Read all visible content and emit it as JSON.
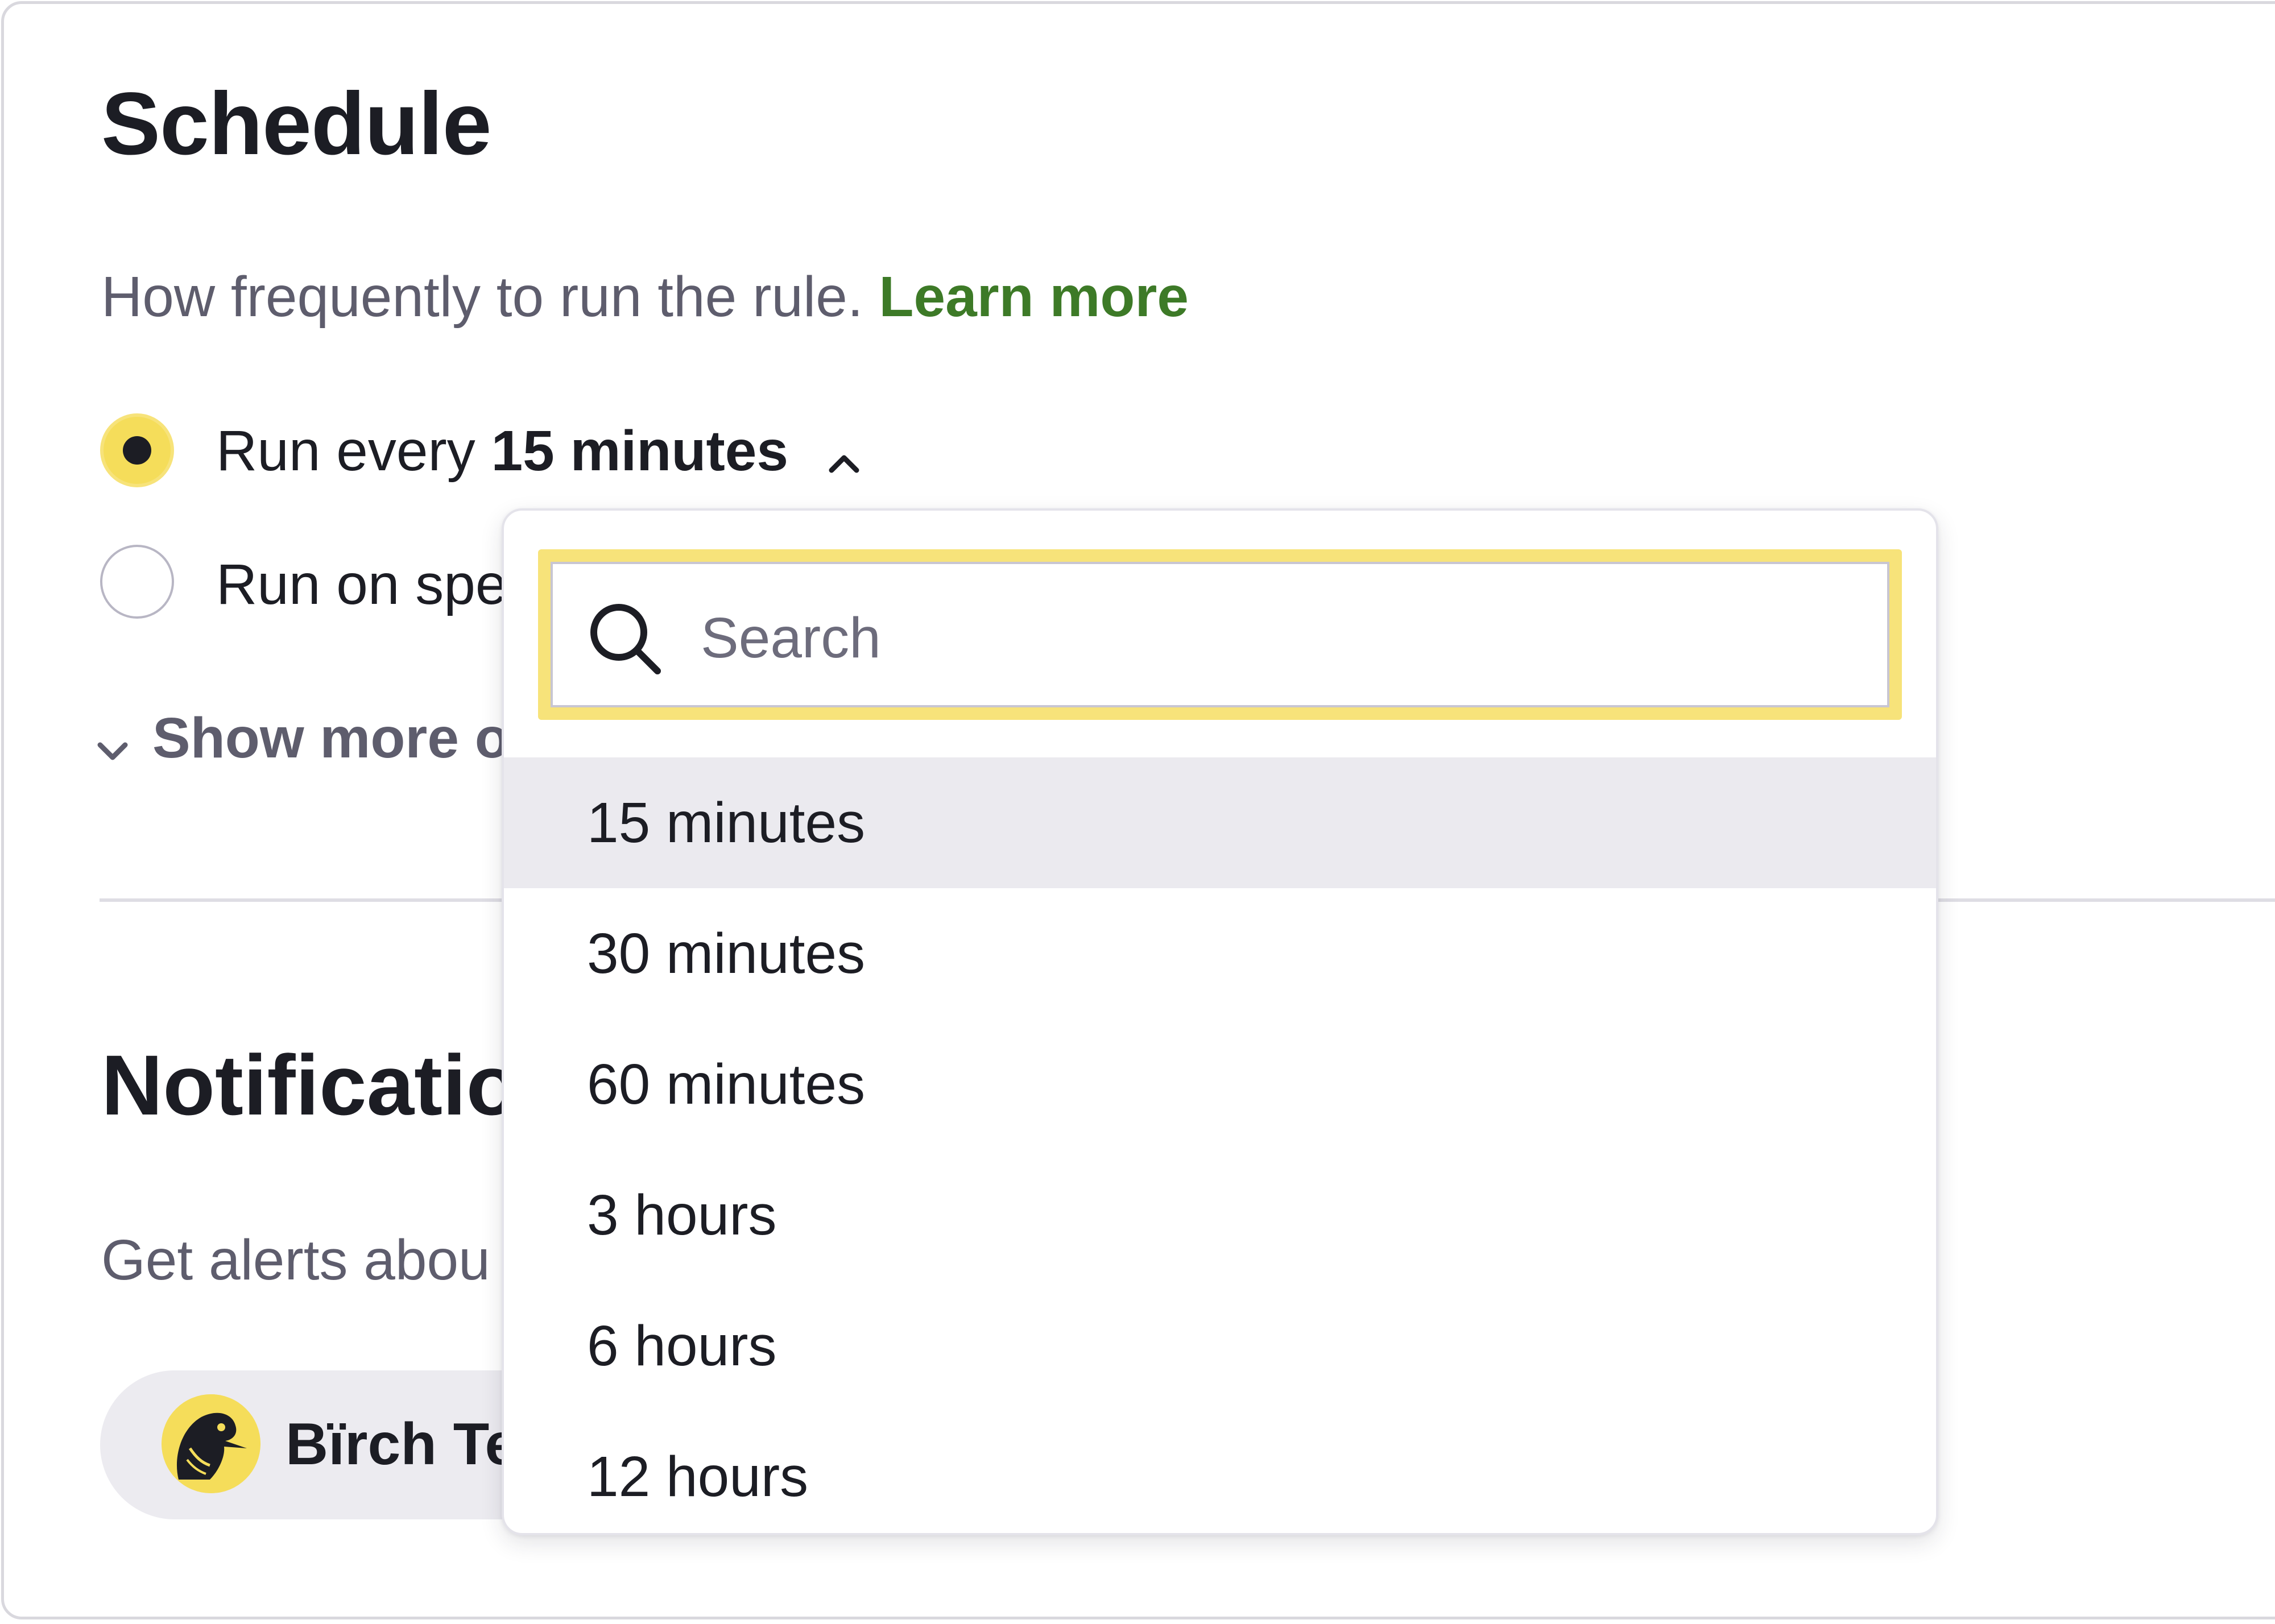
{
  "schedule": {
    "title": "Schedule",
    "description": "How frequently to run the rule.",
    "learn_more": "Learn more",
    "option_every_prefix": "Run every",
    "option_every_value": "15 minutes",
    "option_specific": "Run on spe",
    "show_more": "Show more o"
  },
  "notifications": {
    "title": "Notificatio",
    "description": "Get alerts abou",
    "team_chip": "Bïrch Te"
  },
  "dropdown": {
    "search_placeholder": "Search",
    "options": [
      "15 minutes",
      "30 minutes",
      "60 minutes",
      "3 hours",
      "6 hours",
      "12 hours"
    ],
    "selected_index": 0
  },
  "colors": {
    "accent_yellow": "#f5dd5a",
    "link_green": "#3d7a27",
    "text_dark": "#1c1d24",
    "text_muted": "#5e5d6d"
  },
  "icons": {
    "chevron_up": "chevron-up-icon",
    "chevron_down": "chevron-down-icon",
    "search": "search-icon",
    "avatar": "bird-avatar-icon"
  }
}
